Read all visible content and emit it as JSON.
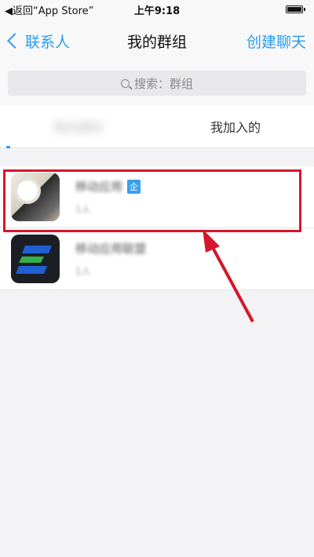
{
  "status": {
    "back_app": "◀返回“App Store”",
    "time": "上午9:18"
  },
  "nav": {
    "back_label": "联系人",
    "title": "我的群组",
    "action_label": "创建聊天"
  },
  "search": {
    "placeholder": "搜索：群组"
  },
  "tabs": [
    {
      "label": "我创建的",
      "blurred": true
    },
    {
      "label": "我加入的",
      "blurred": false
    }
  ],
  "groups": [
    {
      "name": "移动应用",
      "members": "1人",
      "badge": "企"
    },
    {
      "name": "移动应用联盟",
      "members": "1人"
    }
  ],
  "colors": {
    "accent": "#2a9bf0",
    "highlight": "#d5162b",
    "badge": "#3aa0ee"
  }
}
